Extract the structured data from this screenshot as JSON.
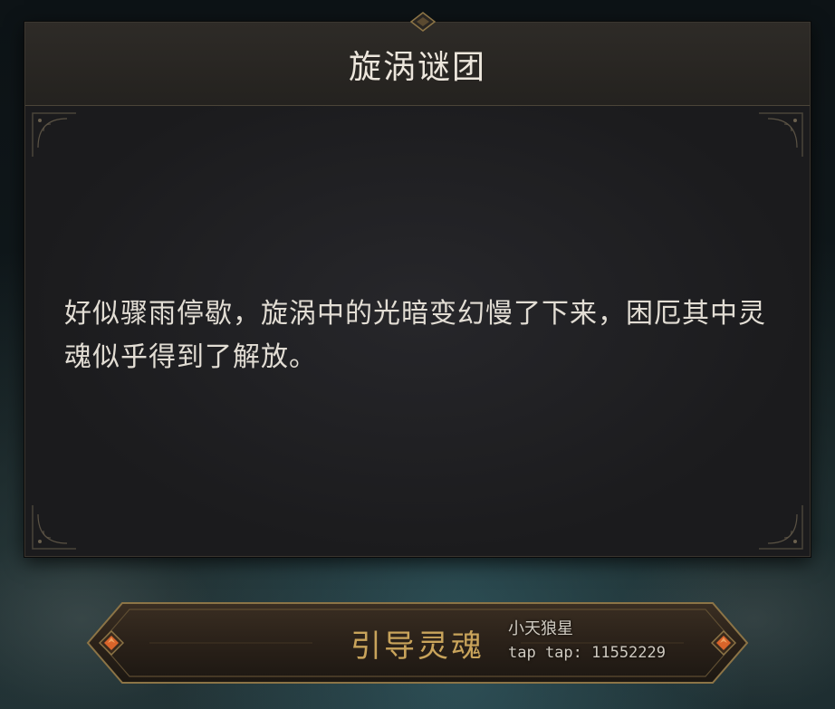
{
  "dialog": {
    "title": "旋涡谜团",
    "message": "好似骤雨停歇，旋涡中的光暗变幻慢了下来，困厄其中灵魂似乎得到了解放。"
  },
  "action": {
    "label": "引导灵魂"
  },
  "watermark": {
    "line1": "小天狼星",
    "line2": "tap tap: 11552229"
  },
  "colors": {
    "title_text": "#ece6dc",
    "body_text": "#e2ddd4",
    "button_text": "#c9a45b",
    "gem": "#d9642a",
    "frame_gold": "#8c7446"
  },
  "icons": {
    "top_ornament": "diamond-ornament-icon",
    "corner": "filigree-corner-icon",
    "button_gem": "orange-gem-icon"
  }
}
